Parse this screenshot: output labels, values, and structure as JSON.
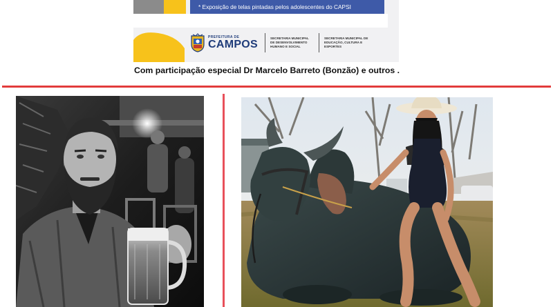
{
  "flyer": {
    "banner_text": "* Exposição de telas pintadas pelos adolescentes do CAPSI",
    "prefeitura_label": "PREFEITURA DE",
    "city_name": "CAMPOS",
    "secretaria_1": "SECRETARIA MUNICIPAL DE DESENVOLVIMENTO HUMANO E SOCIAL",
    "secretaria_2": "SECRETARIA MUNICIPAL DE EDUCAÇÃO, CULTURA E ESPORTES",
    "caption": "Com participação especial  Dr Marcelo Barreto (Bonzão) e outros ."
  },
  "colors": {
    "banner_blue": "#3e5aa8",
    "accent_yellow": "#f7c21b",
    "divider_red": "#e23b3b",
    "logo_blue": "#1f3c7a"
  },
  "photos": {
    "left": "black-and-white photo of a bearded man holding a beer mug",
    "right": "photo of a woman in a cowboy hat sitting on a large reclining zebu bull"
  }
}
